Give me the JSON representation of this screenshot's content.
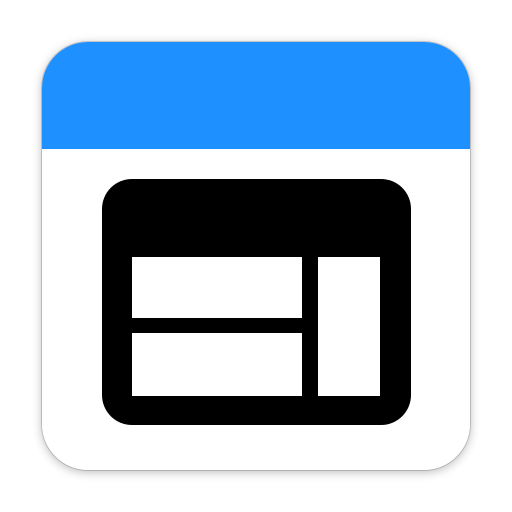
{
  "icon": {
    "name": "layout-panels-icon",
    "colors": {
      "header": "#1e90ff",
      "body": "#ffffff",
      "glyph": "#000000",
      "pane": "#ffffff"
    }
  }
}
